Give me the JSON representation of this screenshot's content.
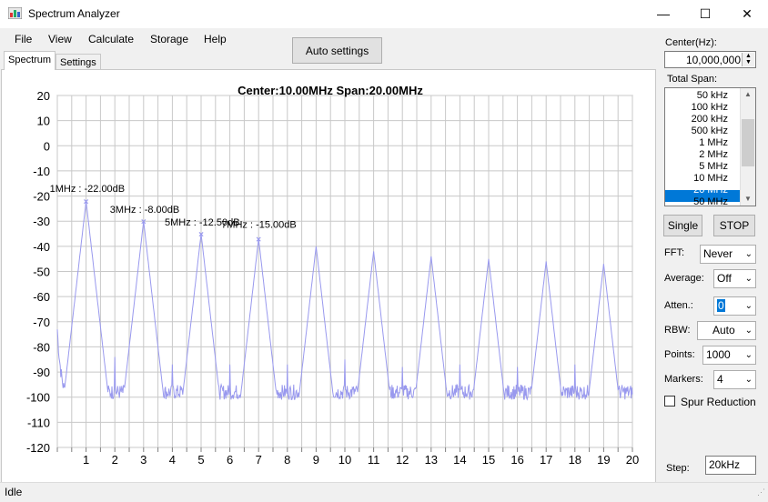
{
  "window": {
    "title": "Spectrum Analyzer",
    "minimize": "—",
    "maximize": "☐",
    "close": "✕"
  },
  "menu": [
    "File",
    "View",
    "Calculate",
    "Storage",
    "Help"
  ],
  "toolbar": {
    "auto_settings": "Auto settings"
  },
  "tabs": [
    "Spectrum",
    "Settings"
  ],
  "chart_data": {
    "type": "line",
    "title": "Center:10.00MHz Span:20.00MHz",
    "xlim": [
      0,
      20
    ],
    "ylim": [
      -120,
      20
    ],
    "x_ticks": [
      "1",
      "2",
      "3",
      "4",
      "5",
      "6",
      "7",
      "8",
      "9",
      "10",
      "11",
      "12",
      "13",
      "14",
      "15",
      "16",
      "17",
      "18",
      "19",
      "20"
    ],
    "y_ticks": [
      "20",
      "10",
      "0",
      "-10",
      "-20",
      "-30",
      "-40",
      "-50",
      "-60",
      "-70",
      "-80",
      "-90",
      "-100",
      "-110",
      "-120"
    ],
    "grid": true,
    "series_color": "#9999ee",
    "peaks": [
      {
        "x": 1,
        "y": -22
      },
      {
        "x": 3,
        "y": -30
      },
      {
        "x": 5,
        "y": -35
      },
      {
        "x": 7,
        "y": -37
      },
      {
        "x": 9,
        "y": -40
      },
      {
        "x": 11,
        "y": -42
      },
      {
        "x": 13,
        "y": -44
      },
      {
        "x": 15,
        "y": -45
      },
      {
        "x": 17,
        "y": -46
      },
      {
        "x": 19,
        "y": -47
      },
      {
        "x": 2,
        "y": -84
      },
      {
        "x": 4,
        "y": -87
      },
      {
        "x": 6,
        "y": -87
      },
      {
        "x": 8,
        "y": -87
      },
      {
        "x": 10,
        "y": -85
      },
      {
        "x": 12,
        "y": -88
      },
      {
        "x": 14,
        "y": -87
      },
      {
        "x": 16,
        "y": -88
      },
      {
        "x": 18,
        "y": -87
      }
    ],
    "noise_floor": -98,
    "markers": [
      {
        "x": 1,
        "y": -22,
        "label": "1MHz : -22.00dB"
      },
      {
        "x": 3,
        "y": -30,
        "label": "3MHz : -8.00dB"
      },
      {
        "x": 5,
        "y": -35,
        "label": "5MHz : -12.50dB"
      },
      {
        "x": 7,
        "y": -37,
        "label": "7MHz : -15.00dB"
      }
    ]
  },
  "panel": {
    "center_label": "Center(Hz):",
    "center_value": "10,000,000",
    "span_label": "Total Span:",
    "span_options": [
      "50 kHz",
      "100 kHz",
      "200 kHz",
      "500 kHz",
      "1 MHz",
      "2 MHz",
      "5 MHz",
      "10 MHz",
      "20 MHz",
      "50 MHz"
    ],
    "span_selected": "20 MHz",
    "single_button": "Single",
    "stop_button": "STOP",
    "fft_label": "FFT:",
    "fft_value": "Never",
    "average_label": "Average:",
    "average_value": "Off",
    "atten_label": "Atten.:",
    "atten_value": "0",
    "rbw_label": "RBW:",
    "rbw_value": "Auto",
    "points_label": "Points:",
    "points_value": "1000",
    "markers_label": "Markers:",
    "markers_value": "4",
    "spur_label": "Spur Reduction",
    "step_label": "Step:",
    "step_value": "20kHz"
  },
  "status": {
    "text": "Idle"
  }
}
